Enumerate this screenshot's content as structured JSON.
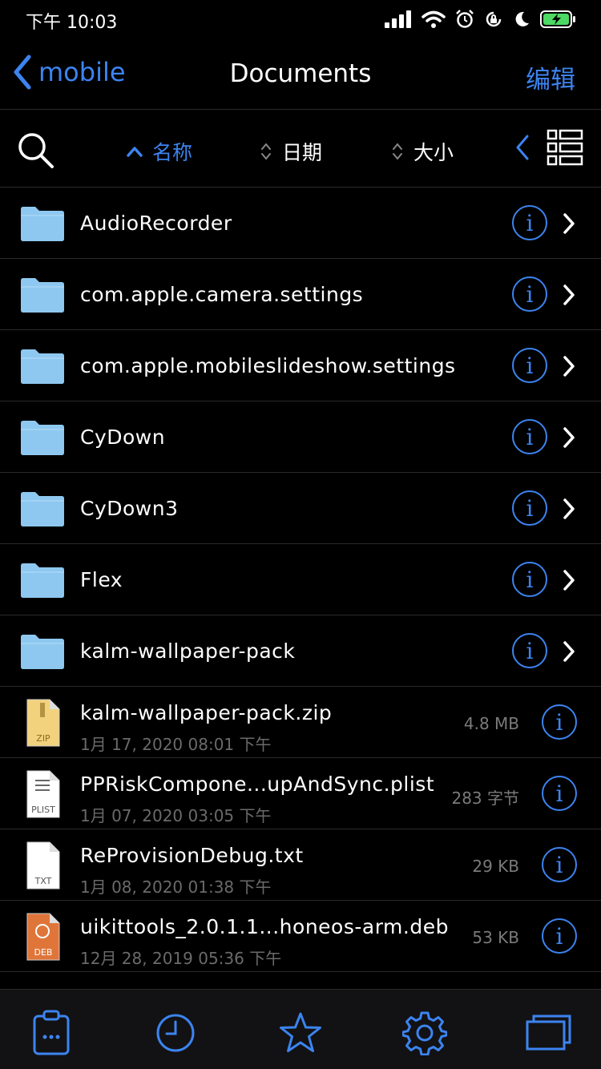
{
  "status_bar": {
    "time": "下午 10:03"
  },
  "nav": {
    "back_label": "mobile",
    "title": "Documents",
    "edit_label": "编辑"
  },
  "sort": {
    "name_label": "名称",
    "date_label": "日期",
    "size_label": "大小",
    "active": "name",
    "direction": "ascending"
  },
  "folders": [
    {
      "name": "AudioRecorder"
    },
    {
      "name": "com.apple.camera.settings"
    },
    {
      "name": "com.apple.mobileslideshow.settings"
    },
    {
      "name": "CyDown"
    },
    {
      "name": "CyDown3"
    },
    {
      "name": "Flex"
    },
    {
      "name": "kalm-wallpaper-pack"
    }
  ],
  "files": [
    {
      "name": "kalm-wallpaper-pack.zip",
      "date": "1月 17, 2020 08:01 下午",
      "size": "4.8 MB",
      "type_label": "ZIP",
      "icon": "zip-file-icon"
    },
    {
      "name": "PPRiskCompone...upAndSync.plist",
      "date": "1月 07, 2020 03:05 下午",
      "size": "283 字节",
      "type_label": "PLIST",
      "icon": "plist-file-icon"
    },
    {
      "name": "ReProvisionDebug.txt",
      "date": "1月 08, 2020 01:38 下午",
      "size": "29 KB",
      "type_label": "TXT",
      "icon": "txt-file-icon"
    },
    {
      "name": "uikittools_2.0.1.1...honeos-arm.deb",
      "date": "12月 28, 2019 05:36 下午",
      "size": "53 KB",
      "type_label": "DEB",
      "icon": "deb-file-icon"
    }
  ],
  "colors": {
    "accent": "#3c84f0",
    "folder": "#8ec8f0",
    "background": "#000000"
  },
  "tabs": [
    {
      "icon": "clipboard-icon"
    },
    {
      "icon": "clock-icon"
    },
    {
      "icon": "star-icon"
    },
    {
      "icon": "gear-icon"
    },
    {
      "icon": "windows-icon"
    }
  ]
}
